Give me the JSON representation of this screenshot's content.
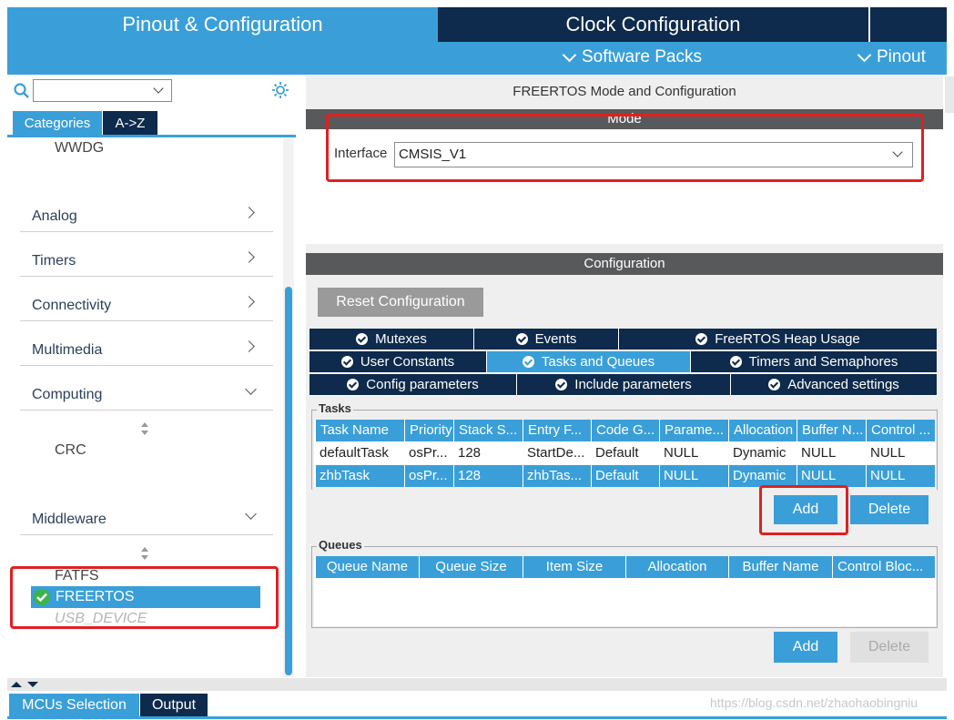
{
  "header": {
    "tab_pinout": "Pinout & Configuration",
    "tab_clock": "Clock Configuration",
    "software_packs": "Software Packs",
    "pinout": "Pinout"
  },
  "sidebar": {
    "search_value": "",
    "tab_categories": "Categories",
    "tab_az": "A->Z",
    "top_item": "WWDG",
    "categories": {
      "analog": "Analog",
      "timers": "Timers",
      "connectivity": "Connectivity",
      "multimedia": "Multimedia",
      "computing": "Computing",
      "middleware": "Middleware"
    },
    "computing_items": [
      "CRC"
    ],
    "middleware_items": [
      "FATFS",
      "FREERTOS",
      "USB_DEVICE"
    ]
  },
  "mode": {
    "title": "FREERTOS Mode and Configuration",
    "section": "Mode",
    "interface_label": "Interface",
    "interface_value": "CMSIS_V1"
  },
  "config": {
    "section": "Configuration",
    "reset_button": "Reset Configuration",
    "tabs_row1": [
      "Mutexes",
      "Events",
      "FreeRTOS Heap Usage"
    ],
    "tabs_row2": [
      "User Constants",
      "Tasks and Queues",
      "Timers and Semaphores"
    ],
    "tabs_row3": [
      "Config parameters",
      "Include parameters",
      "Advanced settings"
    ],
    "active_tab": "Tasks and Queues"
  },
  "tasks": {
    "legend": "Tasks",
    "columns": [
      "Task Name",
      "Priority",
      "Stack S...",
      "Entry F...",
      "Code G...",
      "Parame...",
      "Allocation",
      "Buffer N...",
      "Control ..."
    ],
    "rows": [
      [
        "defaultTask",
        "osPr...",
        "128",
        "StartDe...",
        "Default",
        "NULL",
        "Dynamic",
        "NULL",
        "NULL"
      ],
      [
        "zhbTask",
        "osPr...",
        "128",
        "zhbTas...",
        "Default",
        "NULL",
        "Dynamic",
        "NULL",
        "NULL"
      ]
    ],
    "add": "Add",
    "delete": "Delete"
  },
  "queues": {
    "legend": "Queues",
    "columns": [
      "Queue Name",
      "Queue Size",
      "Item Size",
      "Allocation",
      "Buffer Name",
      "Control Bloc..."
    ],
    "add": "Add",
    "delete": "Delete"
  },
  "bottom": {
    "mcus_selection": "MCUs Selection",
    "output": "Output",
    "watermark": "https://blog.csdn.net/zhaohaobingniu"
  },
  "colors": {
    "accent": "#3a9fd8",
    "navy": "#0e2a4c",
    "highlight": "#e02020"
  }
}
